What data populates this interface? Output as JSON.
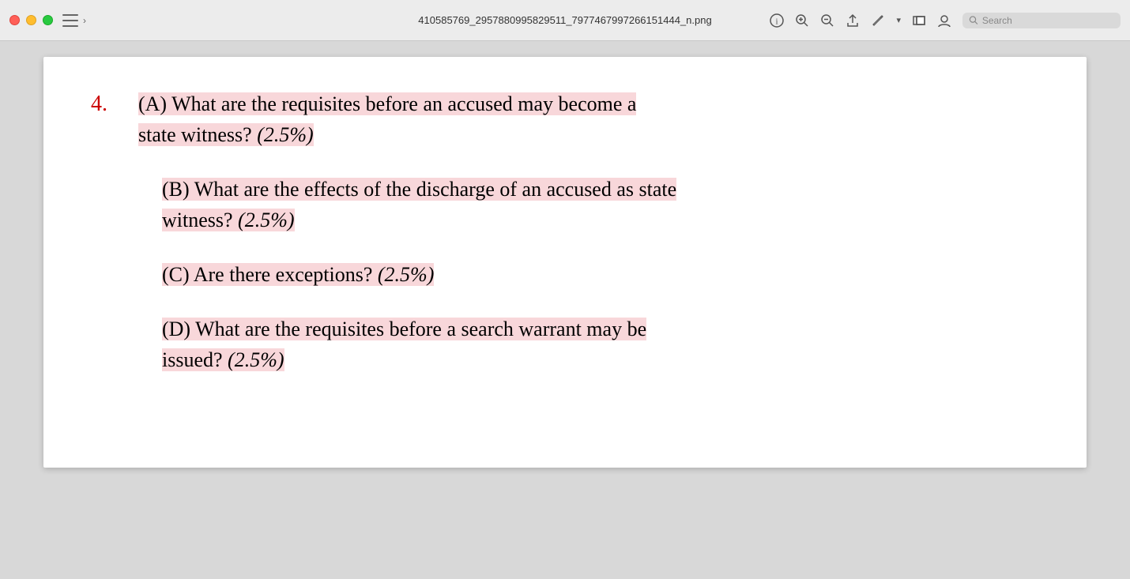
{
  "titlebar": {
    "filename": "410585769_2957880995829511_7977467997266151444_n.png",
    "search_placeholder": "Search"
  },
  "document": {
    "question_number": "4.",
    "parts": [
      {
        "id": "A",
        "text": "(A) What are the requisites before an accused may become a state witness?",
        "points": "(2.5%)"
      },
      {
        "id": "B",
        "text": "(B) What are the effects of the discharge of an accused as state witness?",
        "points": "(2.5%)"
      },
      {
        "id": "C",
        "text": "(C) Are there exceptions?",
        "points": "(2.5%)"
      },
      {
        "id": "D",
        "text": "(D) What are the requisites before a search warrant may be issued?",
        "points": "(2.5%)"
      }
    ]
  },
  "icons": {
    "info": "ℹ",
    "zoom_in": "🔍",
    "zoom_out": "🔍",
    "share": "⬆",
    "pencil": "✏",
    "window": "⧉",
    "account": "👤",
    "search": "🔍",
    "sidebar": "sidebar",
    "chevron": "›"
  },
  "colors": {
    "highlight": "#f8d7da",
    "question_number": "#cc0000",
    "text": "#1a1a1a"
  }
}
